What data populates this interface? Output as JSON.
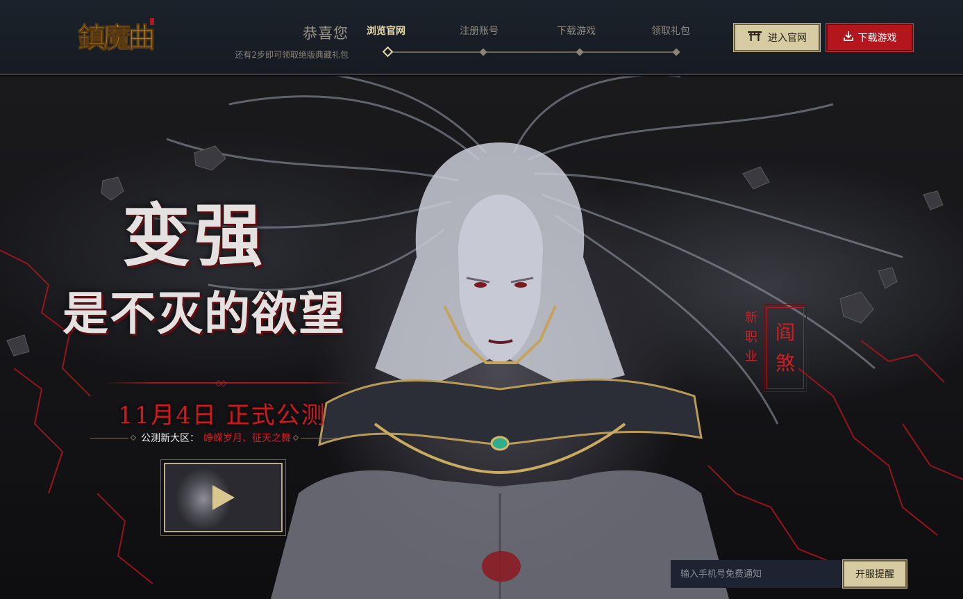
{
  "header": {
    "logo_text": "鎮魔曲",
    "congrats_title": "恭喜您",
    "congrats_subtitle": "还有2步即可领取绝版典藏礼包",
    "steps": [
      {
        "label": "浏览官网",
        "active": true
      },
      {
        "label": "注册账号",
        "active": false
      },
      {
        "label": "下载游戏",
        "active": false
      },
      {
        "label": "领取礼包",
        "active": false
      }
    ],
    "official_button": "进入官网",
    "download_button": "下载游戏"
  },
  "hero": {
    "headline_line1": "变强",
    "headline_line2": "是不灭的欲望",
    "launch_date": "11月4日  正式公测",
    "servers_label": "公测新大区：",
    "servers_value": "峥嵘岁月、征天之舞",
    "class_new_label": "新职业",
    "class_name": "阎煞"
  },
  "notify": {
    "placeholder": "输入手机号免费通知",
    "button": "开服提醒"
  },
  "colors": {
    "accent_gold": "#d7cba4",
    "accent_red": "#b3161d",
    "header_bg": "#1c222b",
    "highlight_red": "#d61c22"
  },
  "icons": {
    "official": "gate-icon",
    "download": "download-icon",
    "play": "play-icon"
  }
}
